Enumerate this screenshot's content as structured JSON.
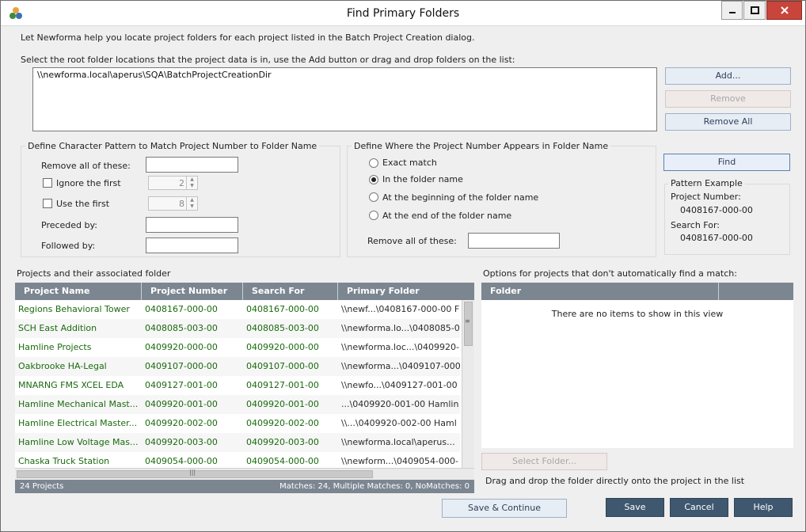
{
  "window": {
    "title": "Find Primary Folders",
    "minimize_icon": "minimize-icon",
    "maximize_icon": "maximize-icon",
    "close_icon": "close-icon",
    "close_color": "#c9443a"
  },
  "intro_text": "Let Newforma help you locate project folders for each project listed in the Batch Project Creation dialog.",
  "root_folders": {
    "label": "Select the root folder locations  that the project data is in, use the Add button or drag and drop folders on the list:",
    "items": [
      "\\\\newforma.local\\aperus\\SQA\\BatchProjectCreationDir"
    ],
    "add_label": "Add...",
    "remove_label": "Remove",
    "remove_all_label": "Remove All"
  },
  "pattern": {
    "title": "Define Character Pattern to Match Project Number to Folder Name",
    "remove_all_label": "Remove all of these:",
    "remove_all_value": "",
    "ignore_first_label": "Ignore the first",
    "ignore_first_checked": false,
    "ignore_first_value": "2",
    "use_first_label": "Use the first",
    "use_first_checked": false,
    "use_first_value": "8",
    "preceded_label": "Preceded by:",
    "preceded_value": "",
    "followed_label": "Followed by:",
    "followed_value": ""
  },
  "location": {
    "title": "Define Where the Project Number Appears in  Folder Name",
    "options": [
      "Exact match",
      "In the folder name",
      "At the beginning of the folder name",
      "At the end of the folder name"
    ],
    "selected": "In the folder name",
    "remove_all_label": "Remove all of these:",
    "remove_all_value": ""
  },
  "find_label": "Find",
  "pattern_example": {
    "title": "Pattern Example",
    "project_number_label": "Project Number:",
    "project_number_value": "0408167-000-00",
    "search_for_label": "Search For:",
    "search_for_value": "0408167-000-00"
  },
  "projects": {
    "label": "Projects and their associated folder",
    "columns": [
      "Project Name",
      "Project Number",
      "Search For",
      "Primary Folder"
    ],
    "rows": [
      [
        "Regions Behavioral Tower",
        "0408167-000-00",
        "0408167-000-00",
        "\\\\newf...\\0408167-000-00 F"
      ],
      [
        "SCH East Addition",
        "0408085-003-00",
        "0408085-003-00",
        "\\\\newforma.lo...\\0408085-0"
      ],
      [
        "Hamline Projects",
        "0409920-000-00",
        "0409920-000-00",
        "\\\\newforma.loc...\\0409920-"
      ],
      [
        "Oakbrooke HA-Legal",
        "0409107-000-00",
        "0409107-000-00",
        "\\\\newforma...\\0409107-000"
      ],
      [
        "MNARNG FMS XCEL EDA",
        "0409127-001-00",
        "0409127-001-00",
        "\\\\newfo...\\0409127-001-00"
      ],
      [
        "Hamline Mechanical Mast...",
        "0409920-001-00",
        "0409920-001-00",
        "...\\0409920-001-00 Hamlin"
      ],
      [
        "Hamline Electrical Master...",
        "0409920-002-00",
        "0409920-002-00",
        "\\\\...\\0409920-002-00 Haml"
      ],
      [
        "Hamline Low Voltage Mas...",
        "0409920-003-00",
        "0409920-003-00",
        "\\\\newforma.local\\aperus..."
      ],
      [
        "Chaska Truck Station",
        "0409054-000-00",
        "0409054-000-00",
        "\\\\newform...\\0409054-000-"
      ]
    ],
    "status_count": "24 Projects",
    "status_matches": "Matches: 24, Multiple Matches: 0, NoMatches: 0"
  },
  "options": {
    "label": "Options for projects that don't automatically find a match:",
    "column": "Folder",
    "empty_text": "There are no items to show in this view",
    "select_folder_label": "Select Folder...",
    "drag_hint": "Drag and drop the folder directly onto the project in the list"
  },
  "footer": {
    "save_continue_label": "Save & Continue",
    "save_label": "Save",
    "cancel_label": "Cancel",
    "help_label": "Help"
  }
}
